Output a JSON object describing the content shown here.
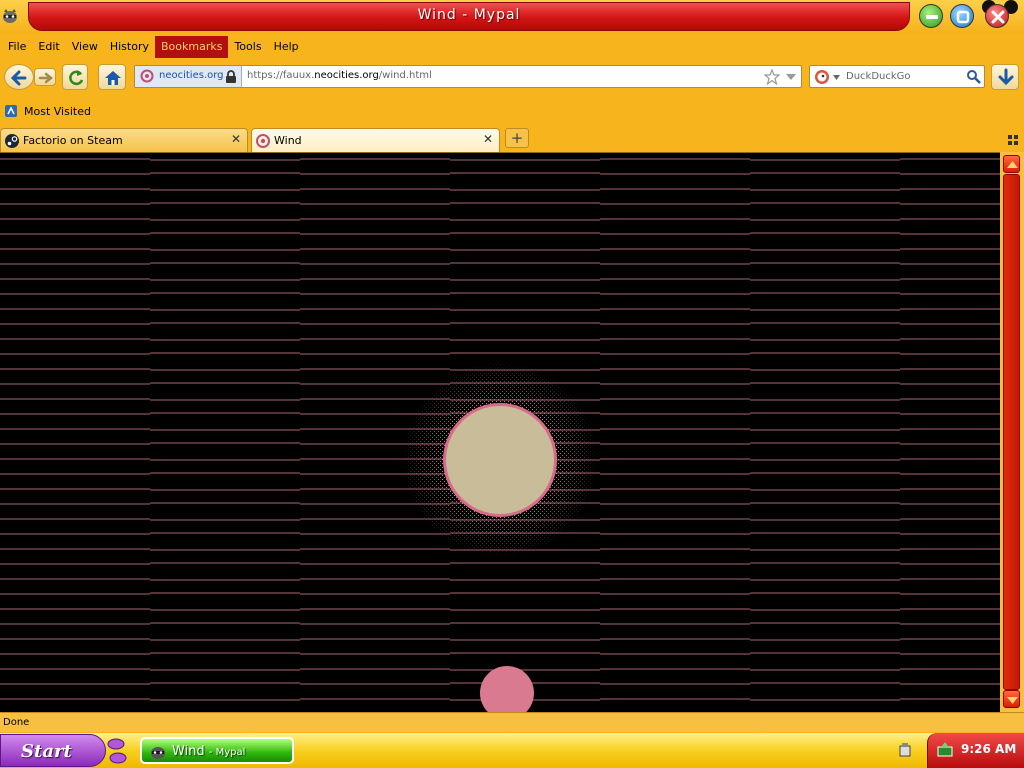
{
  "window": {
    "title": "Wind - Mypal",
    "icon": "mypal-raccoon-icon"
  },
  "menu": {
    "items": [
      "File",
      "Edit",
      "View",
      "History",
      "Bookmarks",
      "Tools",
      "Help"
    ],
    "active": "Bookmarks"
  },
  "nav": {
    "identity_domain": "neocities.org",
    "url_prefix": "https://fauux.",
    "url_host": "neocities.org",
    "url_path": "/wind.html",
    "search_placeholder": "DuckDuckGo"
  },
  "bookmarks": {
    "most_visited": "Most Visited"
  },
  "tabs": [
    {
      "label": "Factorio on Steam",
      "selected": false,
      "icon": "steam-icon"
    },
    {
      "label": "Wind",
      "selected": true,
      "icon": "neocities-icon"
    }
  ],
  "content": {
    "background": "#000000",
    "line_color": "#c77a8a",
    "sun_color": "#c9bc98",
    "sun_glow_color": "#d86a8a",
    "blob_color": "#d97a90"
  },
  "status": {
    "text": "Done"
  },
  "taskbar": {
    "start_label": "Start",
    "task_title": "Wind",
    "task_app": "Mypal",
    "clock": "9:26 AM"
  },
  "colors": {
    "title_red": "#d41414",
    "chrome_yellow": "#f8b41c",
    "active_menu": "#b40f0f"
  }
}
